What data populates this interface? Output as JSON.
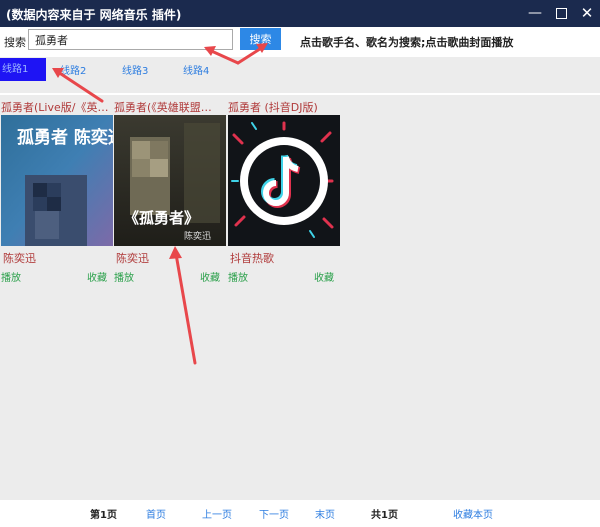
{
  "window": {
    "title": "(数据内容来自于 网络音乐 插件)",
    "controls": [
      "minimize-icon",
      "maximize-icon",
      "close-icon"
    ]
  },
  "search": {
    "label": "搜索",
    "value": "孤勇者",
    "button_label": "搜索",
    "hint": "点击歌手名、歌名为搜索;点击歌曲封面播放"
  },
  "routes": [
    {
      "label": "线路1",
      "active": true
    },
    {
      "label": "线路2",
      "active": false
    },
    {
      "label": "线路3",
      "active": false
    },
    {
      "label": "线路4",
      "active": false
    }
  ],
  "songs": [
    {
      "title": "孤勇者(Live版/《英…",
      "artist": "陈奕迅",
      "play": "播放",
      "fav": "收藏"
    },
    {
      "title": "孤勇者(《英雄联盟…",
      "artist": "陈奕迅",
      "play": "播放",
      "fav": "收藏"
    },
    {
      "title": "孤勇者 (抖音DJ版)",
      "artist": "抖音热歌",
      "play": "播放",
      "fav": "收藏"
    }
  ],
  "covers": [
    {
      "text": "孤勇者 陈奕迅",
      "icon": "album-cover-icon"
    },
    {
      "text": "《孤勇者》",
      "subtext": "陈奕迅",
      "icon": "album-cover-icon"
    },
    {
      "icon": "tiktok-icon"
    }
  ],
  "footer": {
    "page_current": "第1页",
    "first": "首页",
    "prev": "上一页",
    "next": "下一页",
    "last": "末页",
    "total": "共1页",
    "save_page": "收藏本页"
  },
  "colors": {
    "titlebar": "#1b2a4e",
    "accent": "#2d88e6",
    "route_active": "#1e14f4",
    "song_title": "#b03a3a",
    "action_green": "#2aa04a",
    "arrow_red": "#e8474b"
  }
}
